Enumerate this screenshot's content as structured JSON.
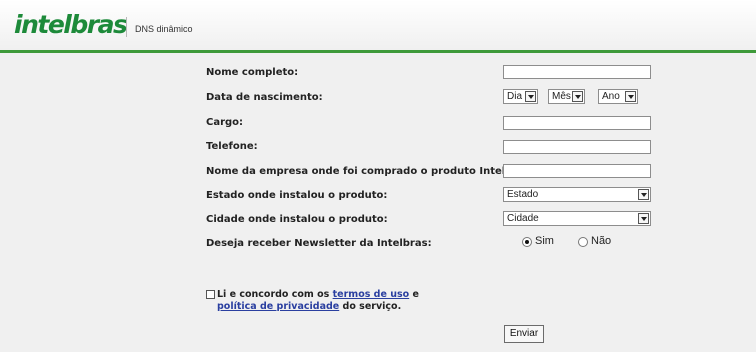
{
  "header": {
    "logo": "intelbras",
    "subtitle": "DNS dinâmico"
  },
  "form": {
    "nome_label": "Nome completo:",
    "nascimento_label": "Data de nascimento:",
    "dia": "Dia",
    "mes": "Mês",
    "ano": "Ano",
    "cargo_label": "Cargo:",
    "telefone_label": "Telefone:",
    "empresa_label": "Nome da empresa onde foi comprado o produto Intelbras:",
    "estado_label": "Estado onde instalou o produto:",
    "estado_value": "Estado",
    "cidade_label": "Cidade onde instalou o produto:",
    "cidade_value": "Cidade",
    "newsletter_label": "Deseja receber Newsletter da Intelbras:",
    "sim": "Sim",
    "nao": "Não",
    "newsletter_selected": "Sim",
    "terms_prefix": "Li e concordo com os ",
    "terms_link": "termos de uso",
    "terms_and": " e",
    "privacy_link": "política de privacidade",
    "terms_suffix": " do serviço.",
    "submit": "Enviar"
  },
  "colors": {
    "brand_green": "#3e9a3a",
    "link_blue": "#2a3fa0"
  }
}
